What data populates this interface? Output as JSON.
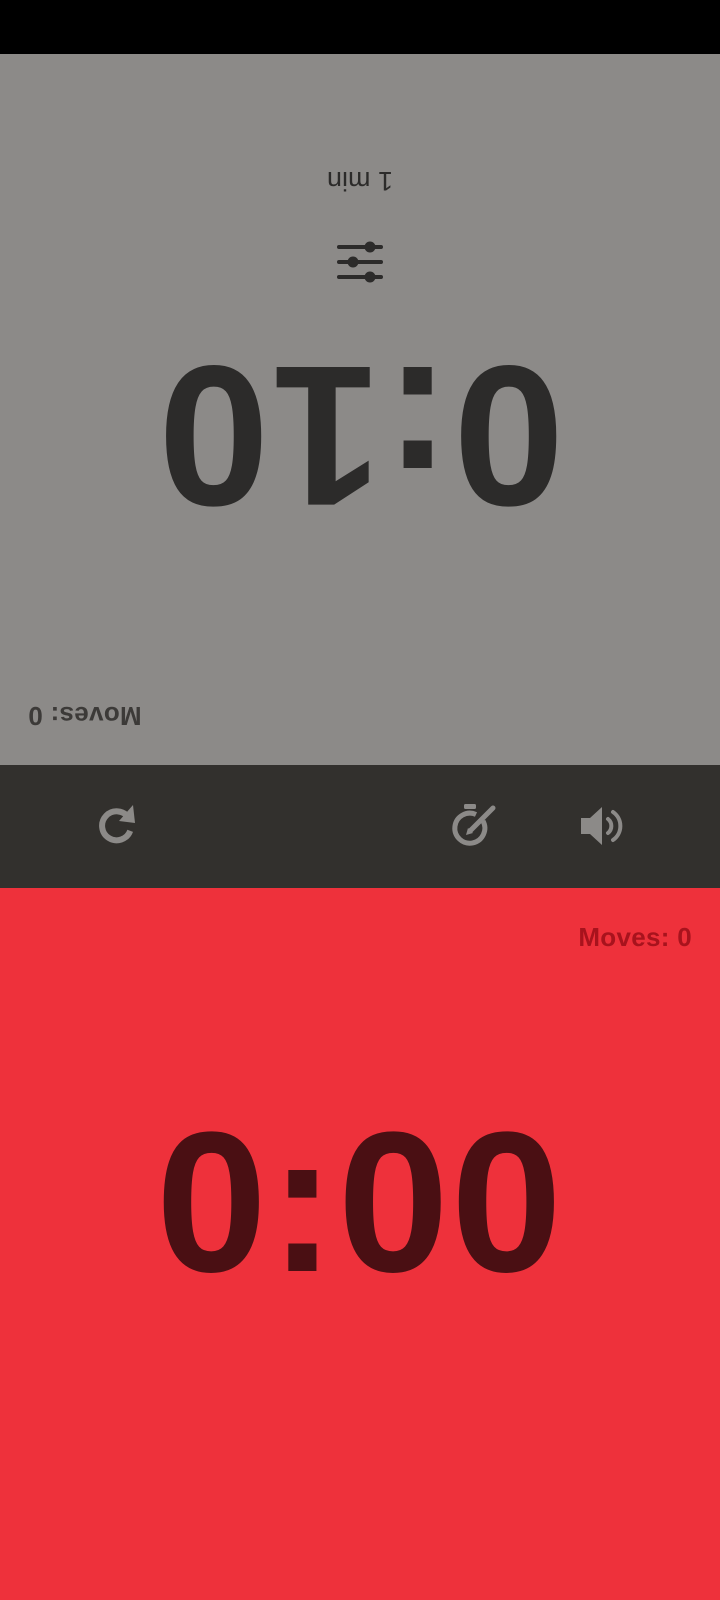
{
  "colors": {
    "status_bar": "#000000",
    "top_panel_bg": "#8c8a88",
    "bottom_panel_bg": "#ee313b",
    "control_bar_bg": "#32302d",
    "control_icon": "#8c8a88",
    "top_text": "#2c2b2a",
    "bottom_time_text": "#4a0f13",
    "bottom_moves_text": "#a8131d"
  },
  "top_player": {
    "orientation": "rotated-180",
    "moves_label": "Moves: 0",
    "time": "0:10",
    "settings_icon": "sliders-icon",
    "preset_label": "1 min"
  },
  "controls": {
    "reset_icon": "refresh-icon",
    "timer_edit_icon": "stopwatch-edit-icon",
    "sound_icon": "volume-icon"
  },
  "bottom_player": {
    "moves_label": "Moves: 0",
    "time": "0:00"
  }
}
